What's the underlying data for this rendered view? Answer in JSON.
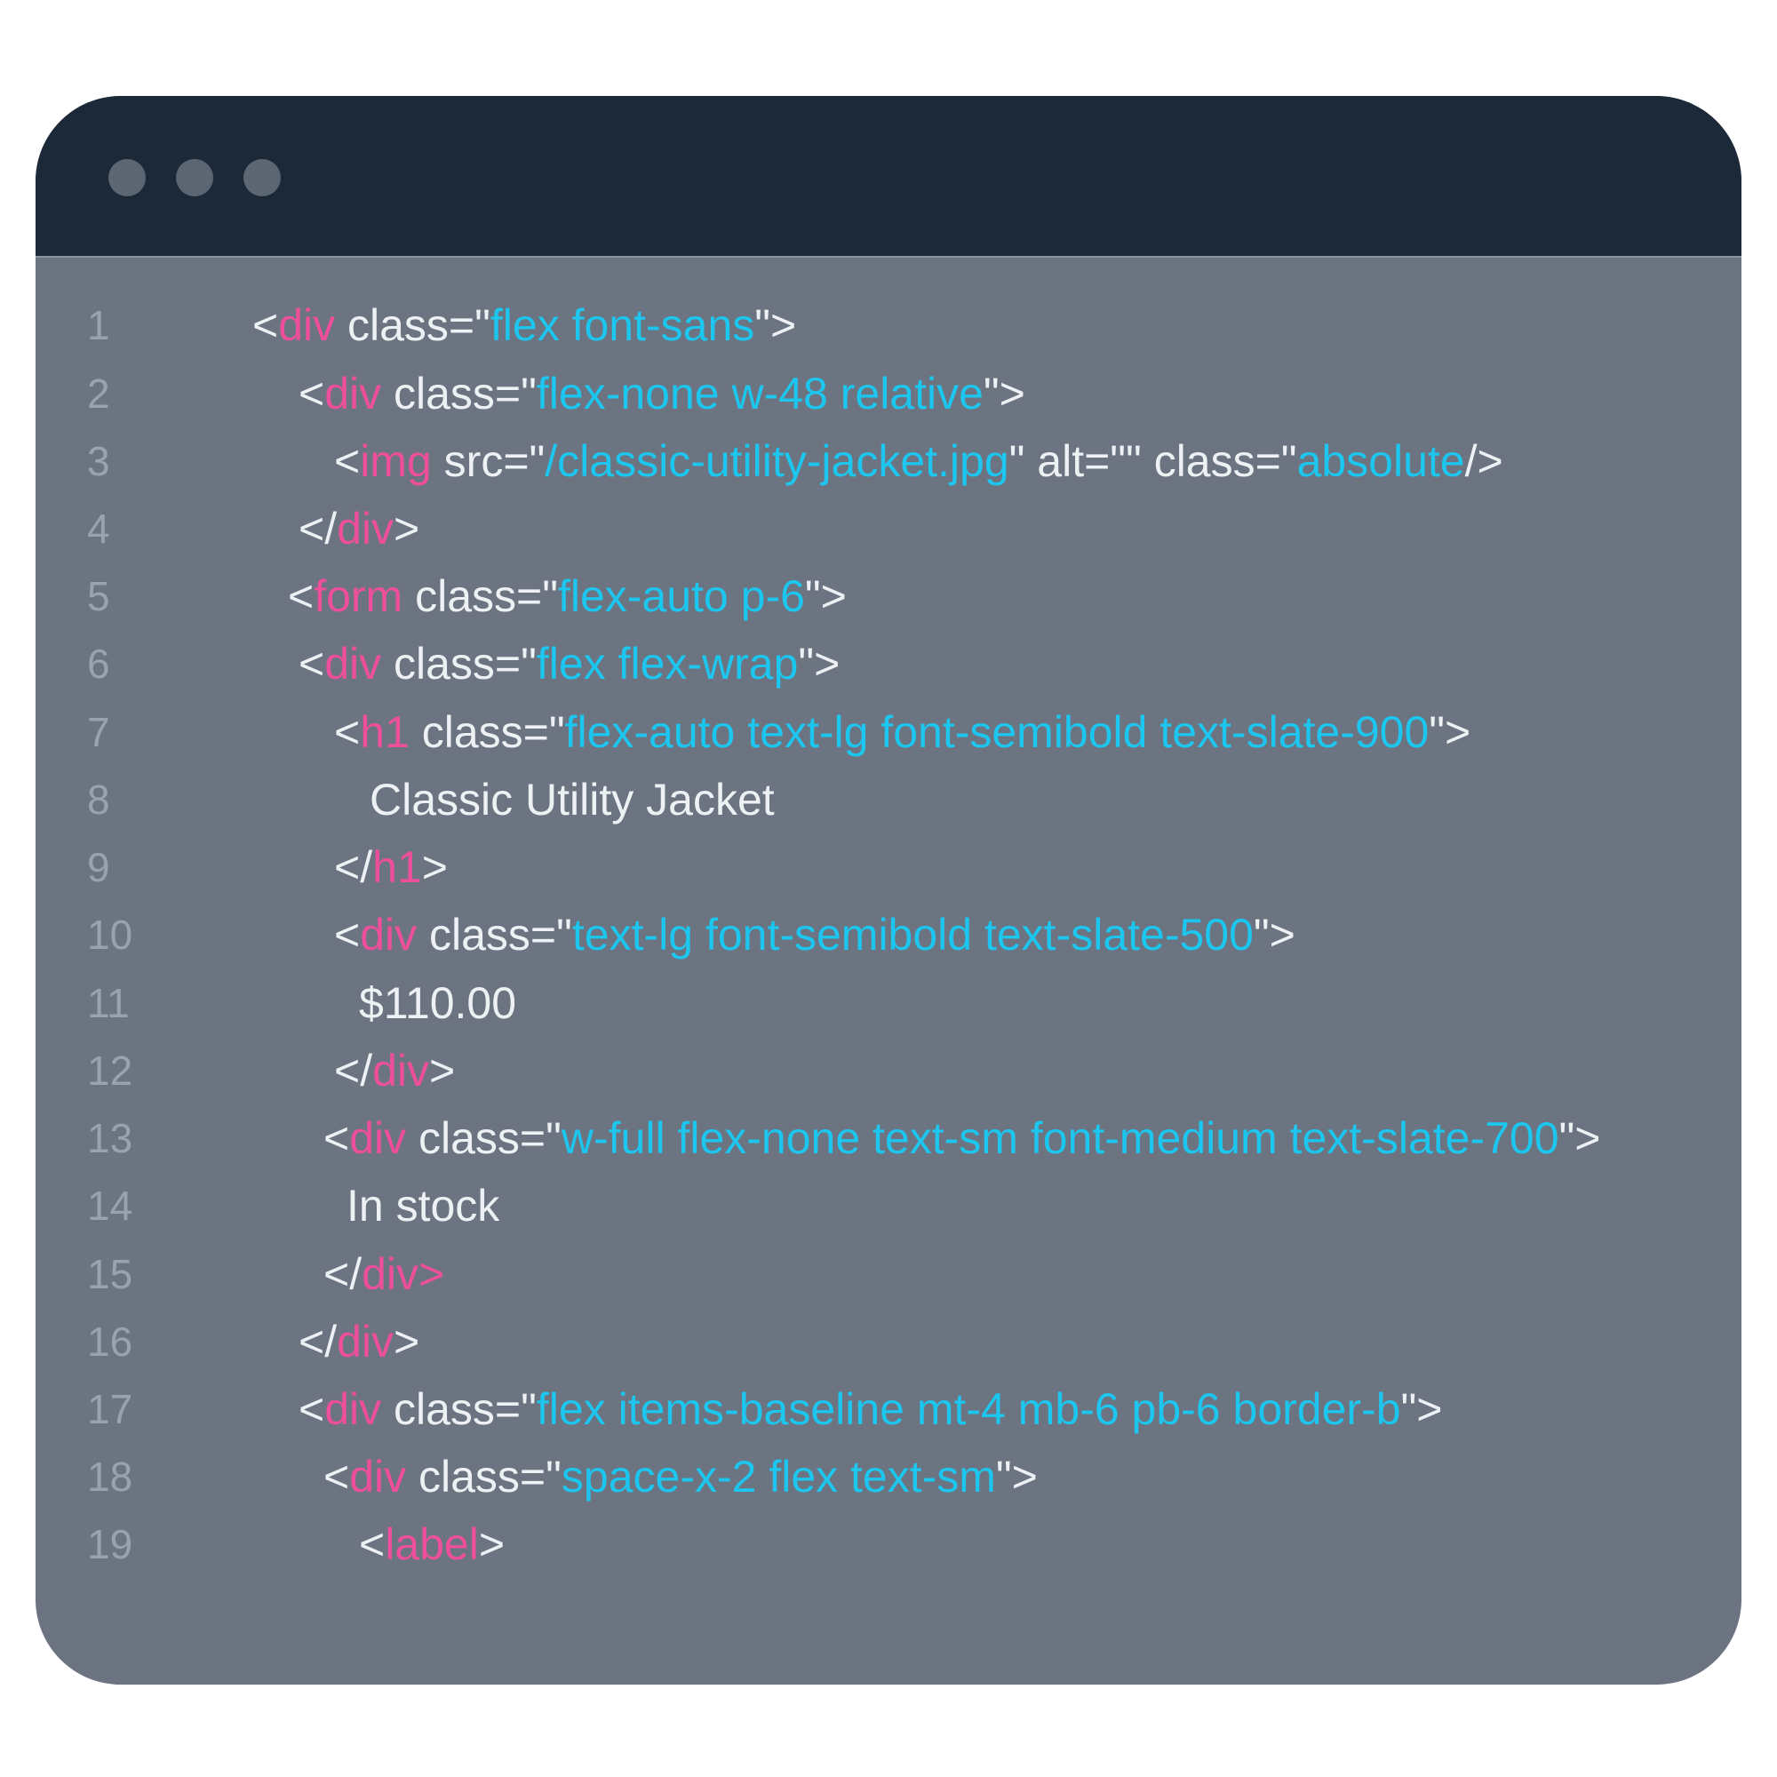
{
  "window_controls": [
    "window-dot",
    "window-dot",
    "window-dot"
  ],
  "colors": {
    "titlebar": "#1c2938",
    "editor_background": "#6b7480",
    "tag": "#ee4f9a",
    "attribute_value": "#1cc6ef",
    "plain_text": "#eef1f4",
    "line_number": "#9aa3ad"
  },
  "lines": [
    {
      "n": "1",
      "tokens": [
        [
          "p",
          "<"
        ],
        [
          "t",
          "div"
        ],
        [
          "p",
          " class=\""
        ],
        [
          "v",
          "flex font-sans"
        ],
        [
          "p",
          "\">"
        ]
      ]
    },
    {
      "n": "2",
      "tokens": [
        [
          "p",
          "<"
        ],
        [
          "t",
          "div"
        ],
        [
          "p",
          " class=\""
        ],
        [
          "v",
          "flex-none w-48 relative"
        ],
        [
          "p",
          "\">"
        ]
      ]
    },
    {
      "n": "3",
      "tokens": [
        [
          "p",
          "<"
        ],
        [
          "t",
          "img"
        ],
        [
          "p",
          " src=\""
        ],
        [
          "v",
          "/classic-utility-jacket.jpg"
        ],
        [
          "p",
          "\" alt=\"\" class=\""
        ],
        [
          "v",
          "absolute"
        ],
        [
          "p",
          "/>"
        ]
      ]
    },
    {
      "n": "4",
      "tokens": [
        [
          "p",
          "</"
        ],
        [
          "t",
          "div"
        ],
        [
          "p",
          ">"
        ]
      ]
    },
    {
      "n": "5",
      "tokens": [
        [
          "p",
          "<"
        ],
        [
          "t",
          "form"
        ],
        [
          "p",
          " class=\""
        ],
        [
          "v",
          "flex-auto p-6"
        ],
        [
          "p",
          "\">"
        ]
      ]
    },
    {
      "n": "6",
      "tokens": [
        [
          "p",
          "<"
        ],
        [
          "t",
          "div"
        ],
        [
          "p",
          " class=\""
        ],
        [
          "v",
          "flex flex-wrap"
        ],
        [
          "p",
          "\">"
        ]
      ]
    },
    {
      "n": "7",
      "tokens": [
        [
          "p",
          "<"
        ],
        [
          "t",
          "h1"
        ],
        [
          "p",
          " class=\""
        ],
        [
          "v",
          "flex-auto text-lg font-semibold text-slate-900"
        ],
        [
          "p",
          "\">"
        ]
      ]
    },
    {
      "n": "8",
      "tokens": [
        [
          "x",
          "Classic Utility Jacket"
        ]
      ]
    },
    {
      "n": "9",
      "tokens": [
        [
          "p",
          "</"
        ],
        [
          "t",
          "h1"
        ],
        [
          "p",
          ">"
        ]
      ]
    },
    {
      "n": "10",
      "tokens": [
        [
          "p",
          "<"
        ],
        [
          "t",
          "div"
        ],
        [
          "p",
          " class=\""
        ],
        [
          "v",
          "text-lg font-semibold text-slate-500"
        ],
        [
          "p",
          "\">"
        ]
      ]
    },
    {
      "n": "11",
      "tokens": [
        [
          "x",
          "$110.00"
        ]
      ]
    },
    {
      "n": "12",
      "tokens": [
        [
          "p",
          "</"
        ],
        [
          "t",
          "div"
        ],
        [
          "p",
          ">"
        ]
      ]
    },
    {
      "n": "13",
      "tokens": [
        [
          "p",
          "<"
        ],
        [
          "t",
          "div"
        ],
        [
          "p",
          " class=\""
        ],
        [
          "v",
          "w-full flex-none text-sm font-medium text-slate-700"
        ],
        [
          "p",
          "\">"
        ]
      ]
    },
    {
      "n": "14",
      "tokens": [
        [
          "x",
          "In stock"
        ]
      ]
    },
    {
      "n": "15",
      "tokens": [
        [
          "p",
          "</"
        ],
        [
          "t",
          "div>"
        ]
      ]
    },
    {
      "n": "16",
      "tokens": [
        [
          "p",
          "</"
        ],
        [
          "t",
          "div"
        ],
        [
          "p",
          ">"
        ]
      ]
    },
    {
      "n": "17",
      "tokens": [
        [
          "p",
          "<"
        ],
        [
          "t",
          "div"
        ],
        [
          "p",
          " class=\""
        ],
        [
          "v",
          "flex items-baseline mt-4 mb-6 pb-6 border-b"
        ],
        [
          "p",
          "\">"
        ]
      ]
    },
    {
      "n": "18",
      "tokens": [
        [
          "p",
          "<"
        ],
        [
          "t",
          "div"
        ],
        [
          "p",
          " class=\""
        ],
        [
          "v",
          "space-x-2 flex text-sm"
        ],
        [
          "p",
          "\">"
        ]
      ]
    },
    {
      "n": "19",
      "tokens": [
        [
          "p",
          "<"
        ],
        [
          "t",
          "label"
        ],
        [
          "p",
          ">"
        ]
      ]
    }
  ]
}
